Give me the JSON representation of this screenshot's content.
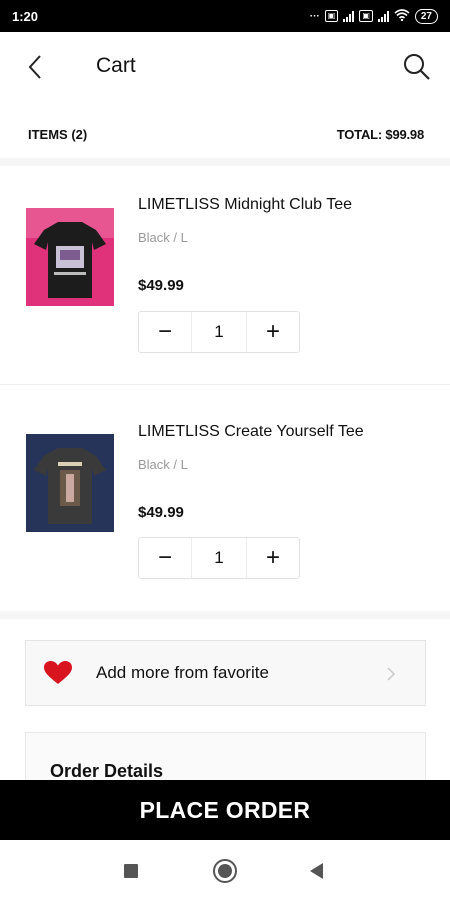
{
  "status_bar": {
    "time": "1:20",
    "battery": "27"
  },
  "header": {
    "title": "Cart"
  },
  "summary": {
    "items_label": "ITEMS (2)",
    "total_label": "TOTAL: $99.98"
  },
  "items": [
    {
      "name": "LIMETLISS Midnight Club Tee",
      "variant": "Black / L",
      "price": "$49.99",
      "quantity": "1",
      "colors": {
        "bg": "#e0327a",
        "shirt": "#1c1c1c"
      }
    },
    {
      "name": "LIMETLISS Create Yourself Tee",
      "variant": "Black / L",
      "price": "$49.99",
      "quantity": "1",
      "colors": {
        "bg": "#27345a",
        "shirt": "#3a3a3a"
      }
    }
  ],
  "favorite": {
    "label": "Add more from favorite",
    "accent": "#d8141e"
  },
  "order_details": {
    "title": "Order Details"
  },
  "place_order": {
    "label": "PLACE ORDER"
  },
  "stepper": {
    "minus": "−",
    "plus": "+"
  }
}
